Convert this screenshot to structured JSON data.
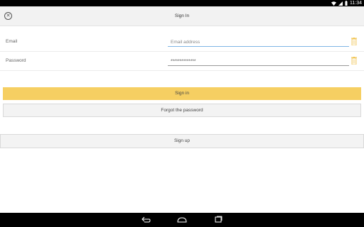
{
  "status_bar": {
    "time": "11:34"
  },
  "header": {
    "title": "Sign In"
  },
  "form": {
    "email": {
      "label": "Email",
      "placeholder": "Email address",
      "value": ""
    },
    "password": {
      "label": "Password",
      "value": "**************"
    }
  },
  "buttons": {
    "sign_in": "Sign in",
    "forgot": "Forgot the password",
    "sign_up": "Sign up"
  },
  "colors": {
    "accent": "#f6cf62",
    "trash_icon": "#f0c24a"
  }
}
